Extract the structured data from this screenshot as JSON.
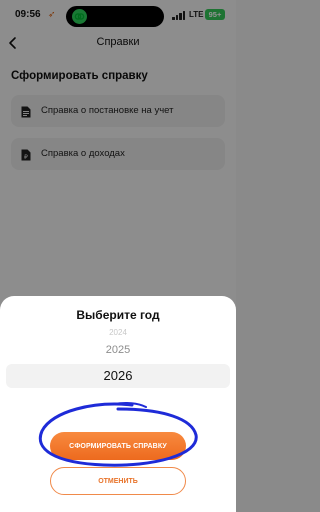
{
  "status_bar": {
    "time": "09:56",
    "network": "LTE",
    "battery": "95+",
    "location_arrow": "➶"
  },
  "nav": {
    "title": "Справки"
  },
  "main": {
    "section_title": "Сформировать справку",
    "documents": [
      {
        "label": "Справка о постановке на учет",
        "icon": "document-icon"
      },
      {
        "label": "Справка о доходах",
        "icon": "document-ruble-icon"
      }
    ]
  },
  "sheet": {
    "title": "Выберите год",
    "years": [
      "2024",
      "2025",
      "2026"
    ],
    "selected_year": "2026",
    "primary_label": "СФОРМИРОВАТЬ СПРАВКУ",
    "secondary_label": "ОТМЕНИТЬ"
  },
  "colors": {
    "accent": "#ED6A1E",
    "annotation": "#1E2BD8",
    "battery": "#34C759"
  }
}
